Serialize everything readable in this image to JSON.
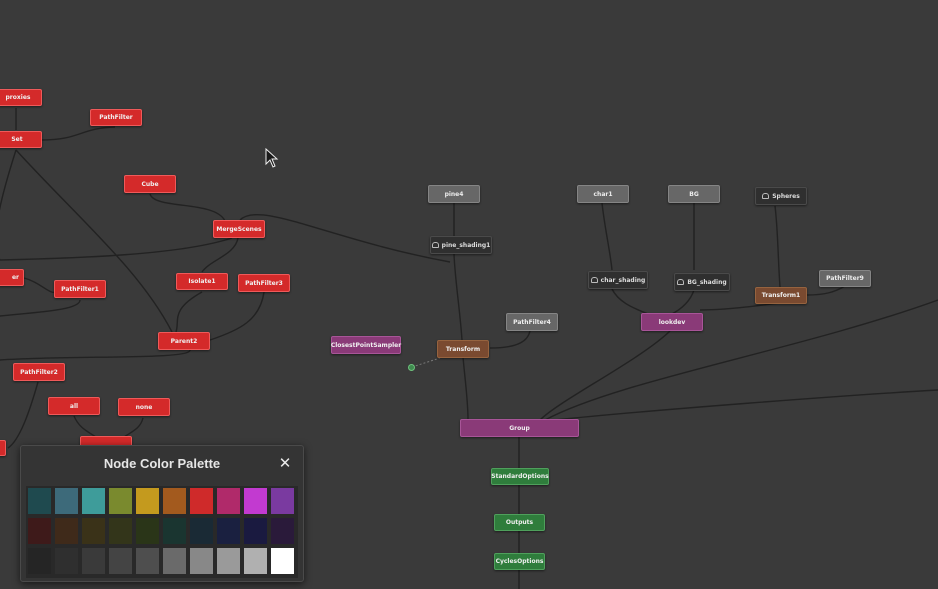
{
  "nodes": [
    {
      "id": "proxies",
      "label": "proxies",
      "color": "red"
    },
    {
      "id": "set",
      "label": "Set",
      "color": "red"
    },
    {
      "id": "pathfilter",
      "label": "PathFilter",
      "color": "red"
    },
    {
      "id": "cube",
      "label": "Cube",
      "color": "red"
    },
    {
      "id": "mergescenes",
      "label": "MergeScenes",
      "color": "red"
    },
    {
      "id": "filter_left",
      "label": "er",
      "color": "red"
    },
    {
      "id": "pathfilter1",
      "label": "PathFilter1",
      "color": "red"
    },
    {
      "id": "isolate1",
      "label": "Isolate1",
      "color": "red"
    },
    {
      "id": "pathfilter3",
      "label": "PathFilter3",
      "color": "red"
    },
    {
      "id": "parent2",
      "label": "Parent2",
      "color": "red"
    },
    {
      "id": "pathfilter2",
      "label": "PathFilter2",
      "color": "red"
    },
    {
      "id": "all",
      "label": "all",
      "color": "red"
    },
    {
      "id": "none",
      "label": "none",
      "color": "red"
    },
    {
      "id": "node_bottom_left",
      "label": "",
      "color": "red"
    },
    {
      "id": "node_bottom_mid",
      "label": "",
      "color": "red"
    },
    {
      "id": "pine4",
      "label": "pine4",
      "color": "gray"
    },
    {
      "id": "pine_shading1",
      "label": "pine_shading1",
      "color": "dark",
      "icon": "shader-icon"
    },
    {
      "id": "closestpointsampler",
      "label": "ClosestPointSampler",
      "color": "purple"
    },
    {
      "id": "transform",
      "label": "Transform",
      "color": "brown"
    },
    {
      "id": "pathfilter4",
      "label": "PathFilter4",
      "color": "gray"
    },
    {
      "id": "char1",
      "label": "char1",
      "color": "gray"
    },
    {
      "id": "char_shading",
      "label": "char_shading",
      "color": "dark",
      "icon": "shader-icon"
    },
    {
      "id": "bg",
      "label": "BG",
      "color": "gray"
    },
    {
      "id": "bg_shading",
      "label": "BG_shading",
      "color": "dark",
      "icon": "shader-icon"
    },
    {
      "id": "spheres",
      "label": "Spheres",
      "color": "dark",
      "icon": "shader-icon"
    },
    {
      "id": "transform1",
      "label": "Transform1",
      "color": "brown"
    },
    {
      "id": "pathfilter9",
      "label": "PathFilter9",
      "color": "gray"
    },
    {
      "id": "lookdev",
      "label": "lookdev",
      "color": "purple"
    },
    {
      "id": "group",
      "label": "Group",
      "color": "purple"
    },
    {
      "id": "standardoptions",
      "label": "StandardOptions",
      "color": "green"
    },
    {
      "id": "outputs",
      "label": "Outputs",
      "color": "green"
    },
    {
      "id": "cyclesoptions",
      "label": "CyclesOptions",
      "color": "green"
    }
  ],
  "palette": {
    "title": "Node Color Palette",
    "close_label": "✕",
    "rows": [
      [
        "#1f4a4f",
        "#3d6a7a",
        "#3e9c9a",
        "#7a8a2e",
        "#c49a1e",
        "#a35a1e",
        "#cf2a2a",
        "#b02a6a",
        "#c23ad0",
        "#7a3aa0"
      ],
      [
        "#3e1a1a",
        "#3f2a1a",
        "#3a3218",
        "#33351a",
        "#2a3518",
        "#1a3530",
        "#1a2a35",
        "#1a2040",
        "#1a1a40",
        "#2a1a3a"
      ],
      [
        "#252525",
        "#2f2f2f",
        "#3a3a3a",
        "#444444",
        "#4e4e4e",
        "#6a6a6a",
        "#888888",
        "#9a9a9a",
        "#b0b0b0",
        "#ffffff"
      ]
    ]
  }
}
